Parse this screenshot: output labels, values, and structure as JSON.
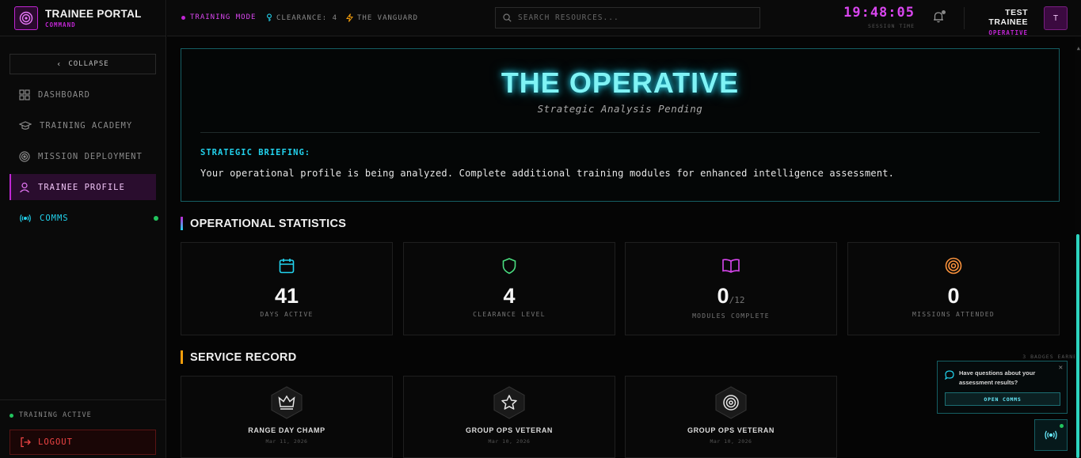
{
  "brand": {
    "title": "TRAINEE PORTAL",
    "subtitle": "COMMAND"
  },
  "sidebar": {
    "collapse_label": "COLLAPSE",
    "items": [
      {
        "label": "DASHBOARD",
        "icon": "grid-icon"
      },
      {
        "label": "TRAINING ACADEMY",
        "icon": "graduation-cap-icon"
      },
      {
        "label": "MISSION DEPLOYMENT",
        "icon": "target-icon"
      },
      {
        "label": "TRAINEE PROFILE",
        "icon": "user-icon",
        "active": true
      },
      {
        "label": "COMMS",
        "icon": "radio-icon",
        "online": true
      }
    ],
    "status": "TRAINING ACTIVE",
    "logout_label": "LOGOUT"
  },
  "header": {
    "mode": "TRAINING MODE",
    "clearance": "CLEARANCE: 4",
    "group": "THE VANGUARD",
    "search_placeholder": "SEARCH RESOURCES...",
    "session_time": "19:48:05",
    "session_label": "SESSION TIME",
    "user_name": "TEST TRAINEE",
    "user_role": "OPERATIVE",
    "avatar_initial": "T"
  },
  "profile": {
    "title": "THE OPERATIVE",
    "subtitle": "Strategic Analysis Pending",
    "briefing_label": "STRATEGIC BRIEFING:",
    "briefing_text": "Your operational profile is being analyzed. Complete additional training modules for enhanced intelligence assessment."
  },
  "stats": {
    "title": "OPERATIONAL STATISTICS",
    "cards": [
      {
        "value": "41",
        "label": "DAYS ACTIVE",
        "icon": "calendar-icon",
        "color": "#22d3ee"
      },
      {
        "value": "4",
        "label": "CLEARANCE LEVEL",
        "icon": "shield-icon",
        "color": "#4ade80"
      },
      {
        "value": "0",
        "suffix": "/12",
        "label": "MODULES COMPLETE",
        "icon": "book-icon",
        "color": "#d946ef"
      },
      {
        "value": "0",
        "label": "MISSIONS ATTENDED",
        "icon": "target-icon",
        "color": "#fb923c"
      }
    ]
  },
  "service_record": {
    "title": "SERVICE RECORD",
    "badges_earned": "3 BADGES EARNED",
    "badges": [
      {
        "name": "RANGE DAY CHAMP",
        "date": "Mar 11, 2026",
        "icon": "crown-icon"
      },
      {
        "name": "GROUP OPS VETERAN",
        "date": "Mar 10, 2026",
        "icon": "star-icon"
      },
      {
        "name": "GROUP OPS VETERAN",
        "date": "Mar 10, 2026",
        "icon": "target-icon"
      }
    ]
  },
  "help": {
    "text": "Have questions about your assessment results?",
    "button_label": "OPEN COMMS"
  },
  "colors": {
    "accent_magenta": "#c026d3",
    "accent_cyan": "#22d3ee",
    "accent_amber": "#f59e0b",
    "danger": "#ef4444",
    "online": "#22c55e"
  }
}
